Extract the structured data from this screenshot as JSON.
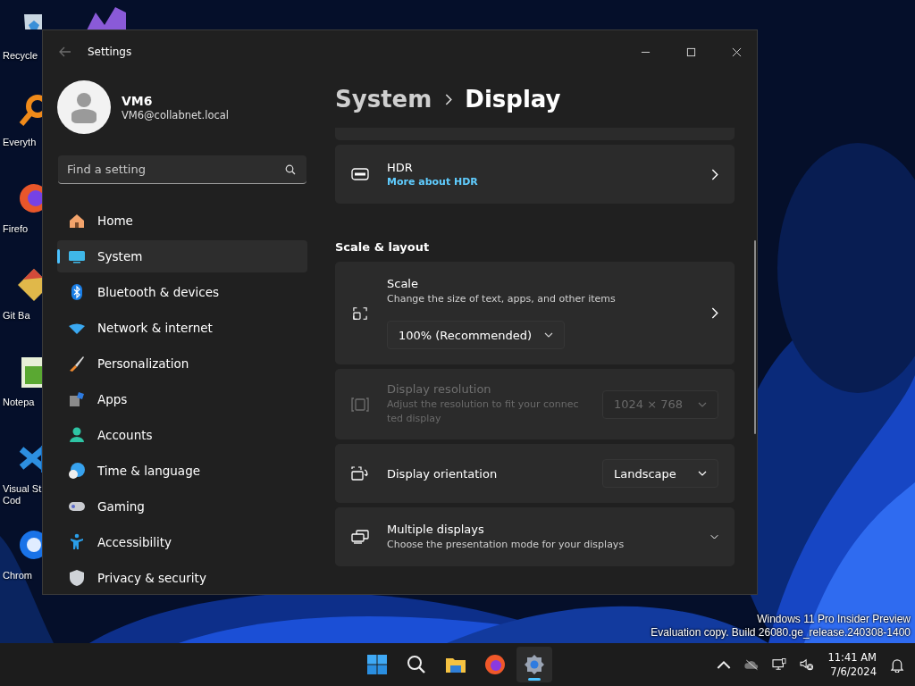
{
  "desktop": {
    "icons": [
      {
        "lines": [
          "Recycle"
        ]
      },
      {
        "lines": [
          "Everyth"
        ]
      },
      {
        "lines": [
          "Firefo"
        ]
      },
      {
        "lines": [
          "Git Ba"
        ]
      },
      {
        "lines": [
          "Notepa"
        ]
      },
      {
        "lines": [
          "Visual St",
          "Cod"
        ]
      },
      {
        "lines": [
          "Chrom"
        ]
      }
    ],
    "watermark": [
      "Windows 11 Pro Insider Preview",
      "Evaluation copy. Build 26080.ge_release.240308-1400"
    ]
  },
  "window": {
    "title": "Settings",
    "profile": {
      "name": "VM6",
      "email": "VM6@collabnet.local"
    },
    "search": {
      "placeholder": "Find a setting"
    },
    "nav": [
      {
        "label": "Home",
        "selected": false
      },
      {
        "label": "System",
        "selected": true
      },
      {
        "label": "Bluetooth & devices",
        "selected": false
      },
      {
        "label": "Network & internet",
        "selected": false
      },
      {
        "label": "Personalization",
        "selected": false
      },
      {
        "label": "Apps",
        "selected": false
      },
      {
        "label": "Accounts",
        "selected": false
      },
      {
        "label": "Time & language",
        "selected": false
      },
      {
        "label": "Gaming",
        "selected": false
      },
      {
        "label": "Accessibility",
        "selected": false
      },
      {
        "label": "Privacy & security",
        "selected": false
      }
    ],
    "breadcrumb": {
      "parent": "System",
      "current": "Display"
    },
    "content": [
      {
        "kind": "link_card",
        "title": "HDR",
        "link": "More about HDR"
      },
      {
        "kind": "heading",
        "text": "Scale & layout"
      },
      {
        "kind": "scale",
        "title": "Scale",
        "description": "Change the size of text, apps, and other items",
        "value": "100% (Recommended)"
      },
      {
        "kind": "dropdown",
        "title": "Display resolution",
        "description": "Adjust the resolution to fit your connected display",
        "value": "1024 × 768",
        "disabled": true
      },
      {
        "kind": "dropdown",
        "title": "Display orientation",
        "value": "Landscape",
        "disabled": false
      },
      {
        "kind": "expander",
        "title": "Multiple displays",
        "description": "Choose the presentation mode for your displays",
        "expanded": false
      }
    ]
  },
  "taskbar": {
    "apps": [
      {
        "selected": false
      },
      {
        "selected": false
      },
      {
        "selected": false
      },
      {
        "selected": false
      },
      {
        "selected": true
      }
    ],
    "time": "11:41 AM",
    "date": "7/6/2024"
  }
}
